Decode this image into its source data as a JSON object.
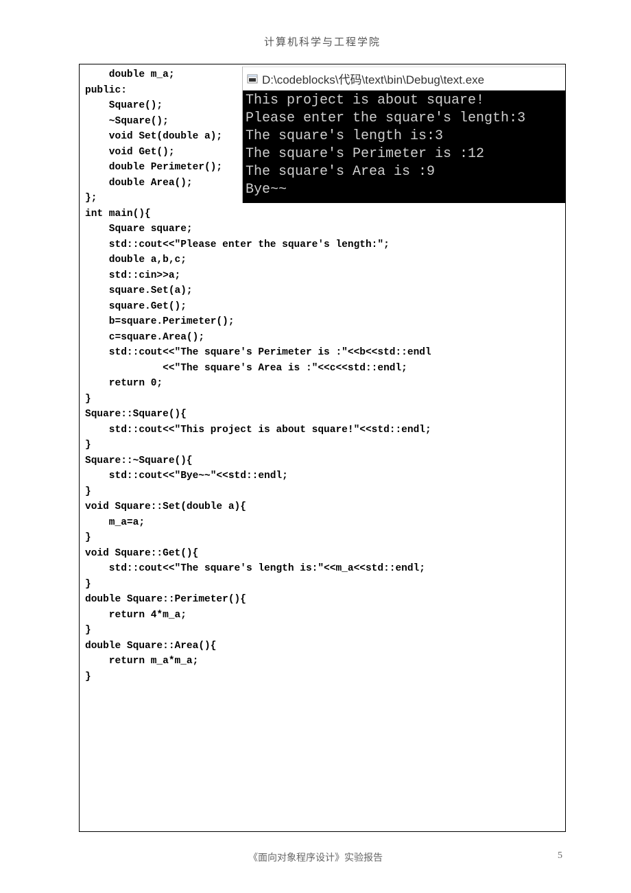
{
  "header": {
    "text": "计算机科学与工程学院"
  },
  "code": {
    "lines": [
      "    double m_a;",
      "public:",
      "    Square();",
      "    ~Square();",
      "    void Set(double a);",
      "    void Get();",
      "    double Perimeter();",
      "    double Area();",
      "};",
      "int main(){",
      "    Square square;",
      "    std::cout<<\"Please enter the square's length:\";",
      "    double a,b,c;",
      "    std::cin>>a;",
      "    square.Set(a);",
      "    square.Get();",
      "    b=square.Perimeter();",
      "    c=square.Area();",
      "    std::cout<<\"The square's Perimeter is :\"<<b<<std::endl",
      "             <<\"The square's Area is :\"<<c<<std::endl;",
      "    return 0;",
      "}",
      "Square::Square(){",
      "    std::cout<<\"This project is about square!\"<<std::endl;",
      "}",
      "Square::~Square(){",
      "    std::cout<<\"Bye~~\"<<std::endl;",
      "}",
      "void Square::Set(double a){",
      "    m_a=a;",
      "}",
      "void Square::Get(){",
      "    std::cout<<\"The square's length is:\"<<m_a<<std::endl;",
      "}",
      "double Square::Perimeter(){",
      "    return 4*m_a;",
      "}",
      "double Square::Area(){",
      "    return m_a*m_a;",
      "}"
    ]
  },
  "console": {
    "title": "D:\\codeblocks\\代码\\text\\bin\\Debug\\text.exe",
    "lines": [
      "This project is about square!",
      "Please enter the square's length:3",
      "The square's length is:3",
      "The square's Perimeter is :12",
      "The square's Area is :9",
      "Bye~~"
    ]
  },
  "footer": {
    "text": "《面向对象程序设计》实验报告",
    "page_number": "5"
  }
}
